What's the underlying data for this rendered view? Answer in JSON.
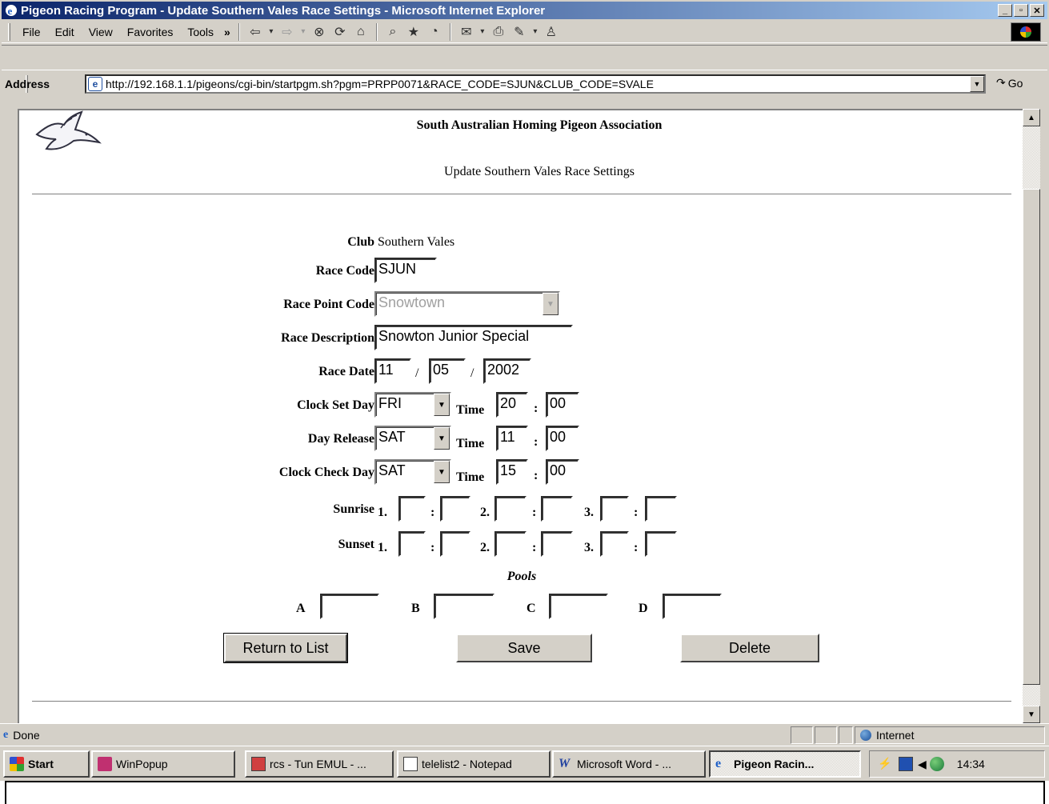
{
  "window": {
    "title": "Pigeon Racing Program - Update Southern Vales Race Settings - Microsoft Internet Explorer",
    "min": "_",
    "max": "▫",
    "close": "✕"
  },
  "menubar": {
    "items": [
      "File",
      "Edit",
      "View",
      "Favorites",
      "Tools"
    ],
    "chevron": "»"
  },
  "toolbar": {
    "icons": [
      "back-icon",
      "forward-icon",
      "stop-icon",
      "refresh-icon",
      "home-icon",
      "search-icon",
      "favorites-icon",
      "history-icon",
      "mail-icon",
      "print-icon",
      "edit-icon",
      "messenger-icon"
    ]
  },
  "addressbar": {
    "label": "Address",
    "url": "http://192.168.1.1/pigeons/cgi-bin/startpgm.sh?pgm=PRPP0071&RACE_CODE=SJUN&CLUB_CODE=SVALE",
    "go": "Go"
  },
  "page": {
    "org": "South Australian Homing Pigeon Association",
    "subtitle": "Update Southern Vales Race Settings",
    "club_label": "Club",
    "club_value": "Southern Vales",
    "race_code_label": "Race Code",
    "race_code": "SJUN",
    "race_point_label": "Race Point Code",
    "race_point": "Snowtown",
    "race_desc_label": "Race Description",
    "race_desc": "Snowton Junior Special",
    "race_date_label": "Race Date",
    "race_date_day": "11",
    "race_date_month": "05",
    "race_date_year": "2002",
    "date_sep": "/",
    "clock_set_label": "Clock Set Day",
    "clock_set_day": "FRI",
    "clock_set_hh": "20",
    "clock_set_mm": "00",
    "day_release_label": "Day Release",
    "day_release": "SAT",
    "release_hh": "11",
    "release_mm": "00",
    "clock_check_label": "Clock Check Day",
    "clock_check_day": "SAT",
    "check_hh": "15",
    "check_mm": "00",
    "time_label": "Time",
    "colon": ":",
    "sunrise_label": "Sunrise",
    "sunset_label": "Sunset",
    "n1": "1.",
    "n2": "2.",
    "n3": "3.",
    "pools_label": "Pools",
    "pool_a": "A",
    "pool_b": "B",
    "pool_c": "C",
    "pool_d": "D",
    "return_btn": "Return to List",
    "save_btn": "Save",
    "delete_btn": "Delete"
  },
  "status": {
    "text": "Done",
    "zone": "Internet"
  },
  "taskbar": {
    "start": "Start",
    "tasks": [
      "WinPopup",
      "rcs - Tun EMUL - ...",
      "telelist2 - Notepad",
      "Microsoft Word - ...",
      "Pigeon Racin..."
    ],
    "clock": "14:34"
  }
}
